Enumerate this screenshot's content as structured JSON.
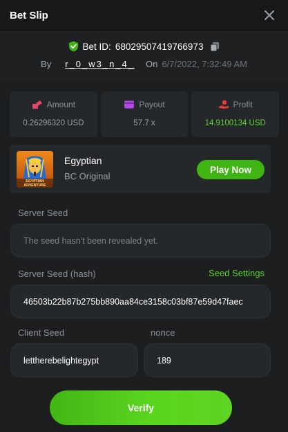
{
  "header": {
    "title": "Bet Slip"
  },
  "bet": {
    "id_label": "Bet ID:",
    "id": "68029507419766973",
    "by_label": "By",
    "username": "r_0_w3_n_4_",
    "on_label": "On",
    "datetime": "6/7/2022, 7:32:49 AM"
  },
  "stats": [
    {
      "label": "Amount",
      "value": "0.26296320 USD",
      "icon": "coins-icon",
      "color": "#e8456b"
    },
    {
      "label": "Payout",
      "value": "57.7 x",
      "icon": "wallet-icon",
      "color": "#b14be6"
    },
    {
      "label": "Profit",
      "value": "14.9100134 USD",
      "icon": "hand-coin-icon",
      "color": "#e63a3a"
    }
  ],
  "game": {
    "name": "Egyptian",
    "provider": "BC Original",
    "thumb_text": "EGYPTIAN ADVENTURE",
    "play_label": "Play Now"
  },
  "server_seed": {
    "label": "Server Seed",
    "placeholder": "The seed hasn't been revealed yet."
  },
  "server_seed_hash": {
    "label": "Server Seed (hash)",
    "value": "46503b22b87b275bb890aa84ce3158c03bf87e59d47faec",
    "settings_label": "Seed Settings"
  },
  "client_seed": {
    "label": "Client Seed",
    "value": "lettherebelightegypt"
  },
  "nonce": {
    "label": "nonce",
    "value": "189"
  },
  "actions": {
    "verify_label": "Verify"
  },
  "colors": {
    "accent_green": "#5ed42a",
    "button_green": "#3fb413",
    "panel": "#25282b",
    "background": "#1c1e20"
  }
}
